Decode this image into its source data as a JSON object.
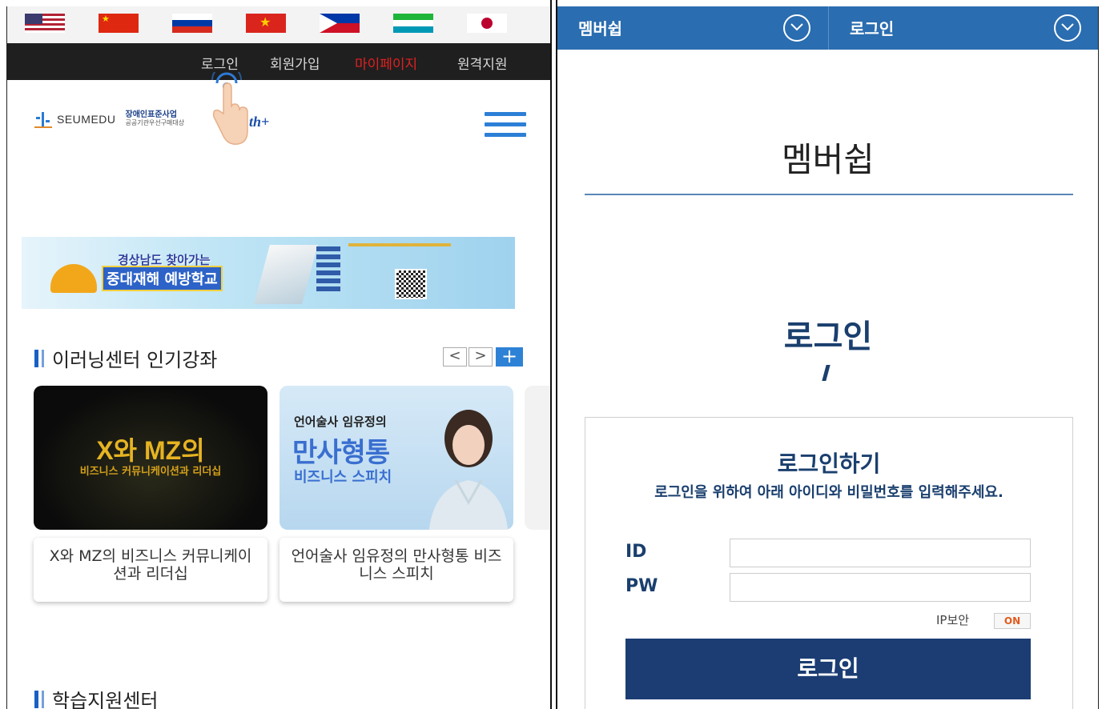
{
  "left": {
    "flags": [
      "us-flag",
      "china-flag",
      "russia-flag",
      "vietnam-flag",
      "philippines-flag",
      "uzbekistan-flag",
      "japan-flag"
    ],
    "topnav": {
      "login": "로그인",
      "join": "회원가입",
      "mypage": "마이페이지",
      "remote": "원격지원"
    },
    "logo": {
      "name": "SEUMEDU",
      "sub1": "장애인표준사업",
      "sub2": "공공기관우선구매대상",
      "suffix": "th+"
    },
    "banner": {
      "line1": "경상남도 찾아가는",
      "line2": "중대재해 예방학교"
    },
    "section1": {
      "title": "이러닝센터 인기강좌",
      "prev": "<",
      "next": ">",
      "more": "+"
    },
    "courses": [
      {
        "thumb_big": "X와 MZ의",
        "thumb_small": "비즈니스 커뮤니케이션과 리더십",
        "caption": "X와 MZ의 비즈니스 커뮤니케이션과 리더십"
      },
      {
        "thumb_l1": "언어술사 임유정의",
        "thumb_l2": "만사형통",
        "thumb_l3": "비즈니스 스피치",
        "caption": "언어술사 임유정의 만사형통 비즈니스 스피치"
      }
    ],
    "section2": {
      "title": "학습지원센터"
    }
  },
  "right": {
    "header": {
      "tab1": "멤버쉽",
      "tab2": "로그인"
    },
    "page_title": "멤버쉽",
    "login_heading": "로그인",
    "box": {
      "heading": "로그인하기",
      "desc": "로그인을 위하여 아래 아이디와 비밀번호를 입력해주세요.",
      "id_label": "ID",
      "pw_label": "PW",
      "id_value": "",
      "pw_value": "",
      "ip_security": "IP보안",
      "ip_toggle": "ON",
      "submit": "로그인"
    }
  },
  "colors": {
    "header_blue": "#2a6db0",
    "navy": "#1b3d73",
    "accent_red": "#e02020",
    "toggle_orange": "#e25a1c"
  }
}
